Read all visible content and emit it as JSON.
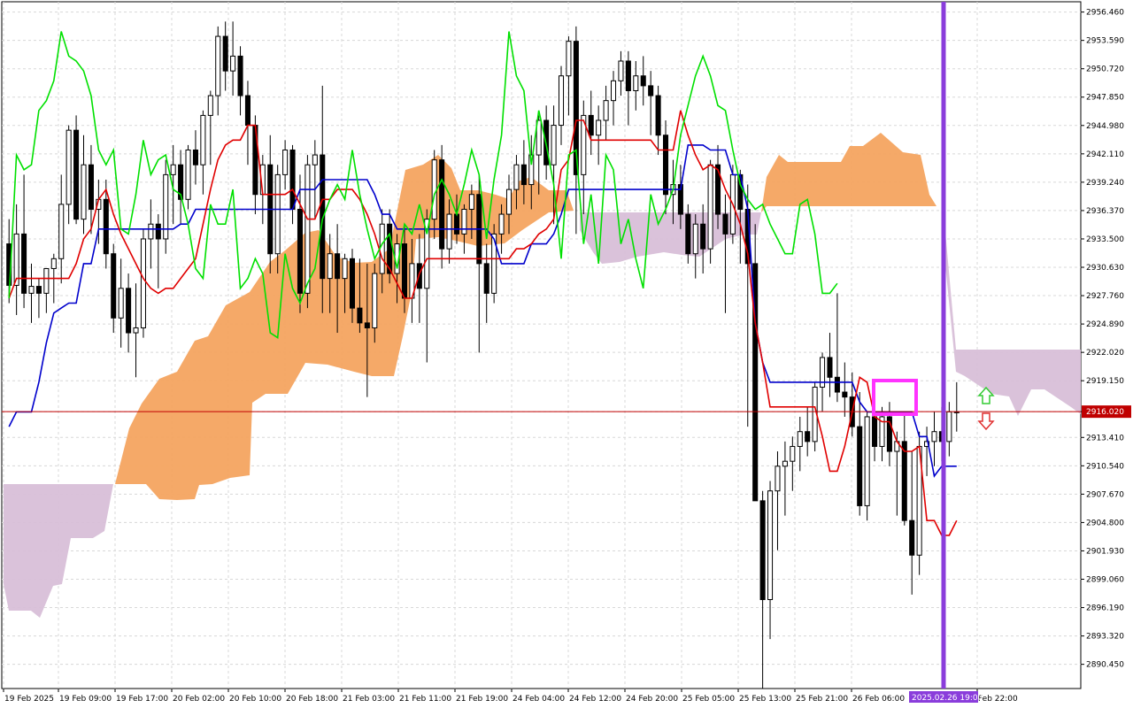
{
  "chart_data": {
    "type": "candlestick",
    "ylim": [
      2888.0,
      2957.5
    ],
    "grid": true,
    "y_ticks": [
      "2956.460",
      "2953.590",
      "2950.720",
      "2947.850",
      "2944.980",
      "2942.110",
      "2939.240",
      "2936.370",
      "2933.500",
      "2930.630",
      "2927.760",
      "2924.890",
      "2922.020",
      "2919.150",
      "2916.020",
      "2913.410",
      "2910.540",
      "2907.670",
      "2904.800",
      "2901.930",
      "2899.060",
      "2896.190",
      "2893.320",
      "2890.450"
    ],
    "x_ticks": [
      "19 Feb 2025",
      "19 Feb 09:00",
      "19 Feb 17:00",
      "20 Feb 02:00",
      "20 Feb 10:00",
      "20 Feb 18:00",
      "21 Feb 03:00",
      "21 Feb 11:00",
      "21 Feb 19:00",
      "24 Feb 04:00",
      "24 Feb 12:00",
      "24 Feb 20:00",
      "25 Feb 05:00",
      "25 Feb 13:00",
      "25 Feb 21:00",
      "26 Feb 06:00",
      "Feb 22:00"
    ],
    "current_price": "2916.020",
    "current_price_color": "#c00000",
    "highlight_time": "2025.02.26 19:00",
    "highlight_color": "#8a3ddb",
    "arrows": {
      "up_color": "#33cc33",
      "down_color": "#e03030"
    },
    "series_colors": {
      "tenkan": "#e00000",
      "kijun": "#0000cc",
      "chikou": "#00e000",
      "kumo_bull": "#f4a460",
      "kumo_bear": "#d8bfd8",
      "candle": "#000000",
      "marker": "#ff33ff"
    },
    "candles": [
      [
        2933.0,
        2935.5,
        2927.0,
        2928.8
      ],
      [
        2928.8,
        2937.0,
        2925.8,
        2934.0
      ],
      [
        2934.0,
        2940.0,
        2926.5,
        2928.0
      ],
      [
        2928.0,
        2931.0,
        2925.0,
        2928.7
      ],
      [
        2928.7,
        2929.5,
        2925.5,
        2928.0
      ],
      [
        2928.0,
        2930.5,
        2926.0,
        2930.5
      ],
      [
        2930.5,
        2932.0,
        2927.0,
        2931.5
      ],
      [
        2931.5,
        2940.0,
        2929.0,
        2937.0
      ],
      [
        2937.0,
        2945.0,
        2935.0,
        2944.5
      ],
      [
        2944.5,
        2946.0,
        2935.0,
        2935.5
      ],
      [
        2935.5,
        2944.0,
        2934.0,
        2941.0
      ],
      [
        2941.0,
        2943.0,
        2934.0,
        2936.5
      ],
      [
        2936.5,
        2939.5,
        2933.0,
        2937.5
      ],
      [
        2937.5,
        2939.5,
        2930.5,
        2932.0
      ],
      [
        2932.0,
        2933.0,
        2924.0,
        2925.5
      ],
      [
        2925.5,
        2931.5,
        2922.5,
        2928.5
      ],
      [
        2928.5,
        2930.0,
        2922.0,
        2924.0
      ],
      [
        2924.0,
        2929.0,
        2919.5,
        2924.5
      ],
      [
        2924.5,
        2934.5,
        2923.5,
        2933.5
      ],
      [
        2933.5,
        2937.5,
        2930.5,
        2935.0
      ],
      [
        2935.0,
        2936.0,
        2928.5,
        2933.5
      ],
      [
        2933.5,
        2941.5,
        2932.0,
        2940.0
      ],
      [
        2940.0,
        2943.0,
        2935.0,
        2941.0
      ],
      [
        2941.0,
        2942.5,
        2935.0,
        2937.5
      ],
      [
        2937.5,
        2943.0,
        2936.5,
        2942.5
      ],
      [
        2942.5,
        2944.5,
        2939.0,
        2941.0
      ],
      [
        2941.0,
        2946.5,
        2938.0,
        2946.0
      ],
      [
        2946.0,
        2948.5,
        2941.0,
        2948.0
      ],
      [
        2948.0,
        2955.0,
        2946.0,
        2954.0
      ],
      [
        2954.0,
        2955.5,
        2948.5,
        2950.5
      ],
      [
        2950.5,
        2955.5,
        2948.0,
        2952.0
      ],
      [
        2952.0,
        2953.0,
        2946.0,
        2948.0
      ],
      [
        2948.0,
        2949.5,
        2941.0,
        2945.0
      ],
      [
        2945.0,
        2946.0,
        2936.0,
        2938.0
      ],
      [
        2938.0,
        2942.0,
        2935.0,
        2941.0
      ],
      [
        2941.0,
        2944.0,
        2930.0,
        2932.0
      ],
      [
        2932.0,
        2941.0,
        2930.0,
        2940.0
      ],
      [
        2940.0,
        2943.5,
        2938.5,
        2942.5
      ],
      [
        2942.5,
        2943.0,
        2935.0,
        2936.5
      ],
      [
        2936.5,
        2940.0,
        2926.0,
        2928.0
      ],
      [
        2928.0,
        2942.0,
        2926.5,
        2941.0
      ],
      [
        2941.0,
        2943.5,
        2935.5,
        2942.0
      ],
      [
        2942.0,
        2949.0,
        2926.0,
        2929.5
      ],
      [
        2929.5,
        2934.0,
        2926.0,
        2932.0
      ],
      [
        2932.0,
        2935.0,
        2924.0,
        2929.5
      ],
      [
        2929.5,
        2932.0,
        2926.0,
        2931.5
      ],
      [
        2931.5,
        2932.5,
        2925.0,
        2926.5
      ],
      [
        2926.5,
        2931.5,
        2924.0,
        2925.0
      ],
      [
        2925.0,
        2931.0,
        2917.5,
        2924.5
      ],
      [
        2924.5,
        2931.0,
        2923.0,
        2930.0
      ],
      [
        2930.0,
        2936.5,
        2928.0,
        2935.0
      ],
      [
        2935.0,
        2936.5,
        2929.0,
        2930.0
      ],
      [
        2930.0,
        2934.0,
        2927.0,
        2933.0
      ],
      [
        2933.0,
        2935.0,
        2926.0,
        2927.5
      ],
      [
        2927.5,
        2933.5,
        2925.0,
        2931.0
      ],
      [
        2931.0,
        2934.0,
        2925.0,
        2928.5
      ],
      [
        2928.5,
        2936.5,
        2921.0,
        2935.5
      ],
      [
        2935.5,
        2942.5,
        2933.5,
        2941.5
      ],
      [
        2941.5,
        2943.0,
        2930.5,
        2932.5
      ],
      [
        2932.5,
        2937.5,
        2931.0,
        2936.0
      ],
      [
        2936.0,
        2938.0,
        2933.0,
        2934.0
      ],
      [
        2934.0,
        2937.0,
        2932.0,
        2936.5
      ],
      [
        2936.5,
        2939.0,
        2933.5,
        2938.0
      ],
      [
        2938.0,
        2940.0,
        2922.0,
        2931.0
      ],
      [
        2931.0,
        2933.0,
        2925.0,
        2928.0
      ],
      [
        2928.0,
        2935.0,
        2927.0,
        2934.0
      ],
      [
        2934.0,
        2937.0,
        2932.0,
        2936.0
      ],
      [
        2936.0,
        2940.0,
        2934.0,
        2938.5
      ],
      [
        2938.5,
        2942.0,
        2936.5,
        2941.0
      ],
      [
        2941.0,
        2943.5,
        2937.0,
        2939.0
      ],
      [
        2939.0,
        2944.0,
        2936.5,
        2942.0
      ],
      [
        2942.0,
        2946.0,
        2938.0,
        2945.5
      ],
      [
        2945.5,
        2947.0,
        2939.5,
        2941.0
      ],
      [
        2941.0,
        2947.0,
        2935.0,
        2945.0
      ],
      [
        2945.0,
        2951.0,
        2943.0,
        2950.0
      ],
      [
        2950.0,
        2954.0,
        2946.0,
        2953.5
      ],
      [
        2953.5,
        2955.0,
        2934.0,
        2940.0
      ],
      [
        2940.0,
        2947.5,
        2936.0,
        2946.0
      ],
      [
        2946.0,
        2948.5,
        2942.0,
        2944.0
      ],
      [
        2944.0,
        2947.0,
        2941.0,
        2945.5
      ],
      [
        2945.5,
        2949.0,
        2943.5,
        2947.5
      ],
      [
        2947.5,
        2950.5,
        2945.0,
        2949.5
      ],
      [
        2949.5,
        2952.5,
        2948.0,
        2951.5
      ],
      [
        2951.5,
        2952.5,
        2945.0,
        2948.5
      ],
      [
        2948.5,
        2951.5,
        2946.5,
        2950.0
      ],
      [
        2950.0,
        2952.0,
        2947.0,
        2949.0
      ],
      [
        2949.0,
        2950.5,
        2944.0,
        2948.0
      ],
      [
        2948.0,
        2949.0,
        2942.0,
        2944.0
      ],
      [
        2944.0,
        2945.5,
        2936.0,
        2938.0
      ],
      [
        2938.0,
        2941.5,
        2935.0,
        2939.0
      ],
      [
        2939.0,
        2941.0,
        2934.5,
        2936.0
      ],
      [
        2936.0,
        2937.0,
        2931.0,
        2932.0
      ],
      [
        2932.0,
        2936.0,
        2929.5,
        2935.0
      ],
      [
        2935.0,
        2937.0,
        2930.0,
        2932.5
      ],
      [
        2932.5,
        2941.5,
        2931.0,
        2941.0
      ],
      [
        2941.0,
        2943.0,
        2934.5,
        2936.0
      ],
      [
        2936.0,
        2938.0,
        2926.0,
        2934.0
      ],
      [
        2934.0,
        2941.0,
        2933.0,
        2940.0
      ],
      [
        2940.0,
        2940.5,
        2931.0,
        2936.5
      ],
      [
        2936.5,
        2939.0,
        2914.5,
        2931.0
      ],
      [
        2931.0,
        2935.0,
        2908.0,
        2907.0
      ],
      [
        2907.0,
        2908.0,
        2888.0,
        2897.0
      ],
      [
        2897.0,
        2909.0,
        2893.0,
        2908.0
      ],
      [
        2908.0,
        2912.0,
        2902.0,
        2910.5
      ],
      [
        2910.5,
        2913.0,
        2905.5,
        2911.0
      ],
      [
        2911.0,
        2913.5,
        2908.0,
        2912.5
      ],
      [
        2912.5,
        2915.5,
        2910.0,
        2914.0
      ],
      [
        2914.0,
        2916.5,
        2911.5,
        2913.0
      ],
      [
        2913.0,
        2919.0,
        2912.0,
        2918.5
      ],
      [
        2918.5,
        2922.0,
        2916.0,
        2921.5
      ],
      [
        2921.5,
        2924.0,
        2917.5,
        2919.5
      ],
      [
        2919.5,
        2928.0,
        2917.0,
        2918.0
      ],
      [
        2918.0,
        2921.0,
        2915.5,
        2917.5
      ],
      [
        2917.5,
        2920.0,
        2913.5,
        2914.5
      ],
      [
        2914.5,
        2918.0,
        2905.5,
        2906.5
      ],
      [
        2906.5,
        2916.0,
        2905.0,
        2915.5
      ],
      [
        2915.5,
        2918.5,
        2911.0,
        2912.5
      ],
      [
        2912.5,
        2916.5,
        2911.0,
        2915.5
      ],
      [
        2915.5,
        2917.0,
        2910.5,
        2912.0
      ],
      [
        2912.0,
        2914.0,
        2905.5,
        2913.0
      ],
      [
        2913.0,
        2916.0,
        2904.5,
        2905.0
      ],
      [
        2905.0,
        2912.0,
        2897.5,
        2901.5
      ],
      [
        2901.5,
        2914.0,
        2899.5,
        2912.5
      ],
      [
        2912.5,
        2914.5,
        2909.5,
        2913.0
      ],
      [
        2913.0,
        2916.0,
        2910.5,
        2914.0
      ],
      [
        2914.0,
        2916.5,
        2911.0,
        2913.0
      ],
      [
        2913.0,
        2917.0,
        2911.5,
        2916.0
      ],
      [
        2916.0,
        2919.0,
        2914.0,
        2916.0
      ]
    ],
    "kijun_values": [
      2914.5,
      2916.0,
      2916.0,
      2916.0,
      2919.0,
      2923.0,
      2926.0,
      2926.5,
      2927.0,
      2927.0,
      2931.0,
      2931.0,
      2934.5,
      2934.5,
      2934.5,
      2934.5,
      2934.5,
      2934.5,
      2934.5,
      2934.5,
      2934.5,
      2934.5,
      2934.5,
      2935.0,
      2935.0,
      2936.5,
      2936.5,
      2936.5,
      2936.5,
      2936.5,
      2936.5,
      2936.5,
      2936.5,
      2936.5,
      2936.5,
      2936.5,
      2936.5,
      2936.5,
      2936.5,
      2938.5,
      2938.5,
      2938.5,
      2939.5,
      2939.5,
      2939.5,
      2939.5,
      2939.5,
      2939.5,
      2939.5,
      2938.0,
      2936.0,
      2936.0,
      2934.5,
      2934.5,
      2934.5,
      2934.5,
      2934.5,
      2934.5,
      2934.5,
      2934.5,
      2934.5,
      2934.5,
      2934.5,
      2934.5,
      2934.5,
      2933.5,
      2931.0,
      2931.0,
      2931.0,
      2931.0,
      2933.0,
      2933.0,
      2933.0,
      2934.0,
      2936.0,
      2938.5,
      2938.5,
      2938.5,
      2938.5,
      2938.5,
      2938.5,
      2938.5,
      2938.5,
      2938.5,
      2938.5,
      2938.5,
      2938.5,
      2938.5,
      2938.5,
      2938.5,
      2938.5,
      2943.0,
      2943.0,
      2943.0,
      2942.5,
      2942.5,
      2942.5,
      2940.0,
      2940.0,
      2936.5,
      2925.0,
      2921.0,
      2919.0,
      2919.0,
      2919.0,
      2919.0,
      2919.0,
      2919.0,
      2919.0,
      2919.0,
      2919.0,
      2919.0,
      2919.0,
      2919.0,
      2917.0,
      2916.0,
      2916.0,
      2916.0,
      2916.0,
      2916.0,
      2916.0,
      2916.0,
      2913.5,
      2913.5,
      2909.5,
      2910.5,
      2910.5,
      2910.5
    ],
    "tenkan_values": [
      2927.5,
      2929.5,
      2929.5,
      2929.5,
      2929.5,
      2929.5,
      2929.5,
      2929.5,
      2929.5,
      2931.0,
      2933.5,
      2934.5,
      2937.5,
      2938.5,
      2936.0,
      2934.0,
      2932.5,
      2931.0,
      2929.5,
      2928.5,
      2928.0,
      2928.5,
      2928.5,
      2929.5,
      2930.5,
      2931.5,
      2935.0,
      2938.5,
      2941.5,
      2943.0,
      2943.5,
      2943.5,
      2945.0,
      2945.0,
      2938.0,
      2938.0,
      2938.0,
      2938.0,
      2938.5,
      2937.0,
      2935.5,
      2935.5,
      2937.5,
      2937.5,
      2938.5,
      2938.5,
      2938.5,
      2937.5,
      2936.0,
      2934.0,
      2931.5,
      2930.5,
      2929.0,
      2927.5,
      2927.5,
      2930.0,
      2931.5,
      2931.5,
      2931.5,
      2931.5,
      2931.5,
      2931.5,
      2931.5,
      2931.5,
      2931.5,
      2931.5,
      2931.5,
      2931.5,
      2932.5,
      2932.5,
      2933.0,
      2934.0,
      2934.5,
      2935.5,
      2940.5,
      2941.5,
      2945.5,
      2945.5,
      2943.5,
      2943.5,
      2943.5,
      2943.5,
      2943.5,
      2943.5,
      2943.5,
      2943.5,
      2943.5,
      2942.5,
      2942.5,
      2942.5,
      2946.5,
      2944.0,
      2942.0,
      2940.5,
      2941.0,
      2940.5,
      2938.5,
      2937.0,
      2935.0,
      2932.0,
      2925.0,
      2921.0,
      2916.5,
      2916.5,
      2916.5,
      2916.5,
      2916.5,
      2916.5,
      2916.5,
      2913.5,
      2910.0,
      2910.0,
      2912.5,
      2916.0,
      2919.5,
      2919.0,
      2915.5,
      2915.0,
      2915.0,
      2913.0,
      2912.0,
      2912.0,
      2912.5,
      2905.0,
      2905.0,
      2903.5,
      2903.5,
      2905.0
    ],
    "chikou_values": [
      2927.5,
      2942.0,
      2940.5,
      2941.0,
      2946.5,
      2947.5,
      2949.5,
      2954.5,
      2952.0,
      2951.5,
      2950.5,
      2948.0,
      2942.5,
      2941.0,
      2942.5,
      2934.5,
      2934.0,
      2938.0,
      2943.5,
      2940.0,
      2941.5,
      2942.0,
      2938.5,
      2938.0,
      2935.0,
      2930.5,
      2929.5,
      2937.0,
      2935.0,
      2935.0,
      2938.5,
      2928.5,
      2929.5,
      2931.5,
      2930.0,
      2924.0,
      2923.5,
      2932.0,
      2928.5,
      2927.0,
      2929.0,
      2930.5,
      2935.5,
      2937.5,
      2939.0,
      2937.5,
      2942.5,
      2938.0,
      2934.5,
      2931.5,
      2933.0,
      2934.0,
      2930.5,
      2935.0,
      2934.0,
      2937.0,
      2934.0,
      2938.0,
      2939.5,
      2938.0,
      2936.0,
      2939.0,
      2942.5,
      2940.0,
      2933.5,
      2939.5,
      2944.0,
      2954.5,
      2950.0,
      2948.5,
      2941.0,
      2946.5,
      2943.0,
      2939.0,
      2931.5,
      2942.0,
      2942.5,
      2933.0,
      2938.0,
      2931.0,
      2942.0,
      2940.5,
      2933.0,
      2935.5,
      2931.5,
      2928.5,
      2938.0,
      2935.0,
      2936.5,
      2938.5,
      2944.0,
      2947.0,
      2950.0,
      2952.0,
      2950.0,
      2947.0,
      2946.5,
      2942.5,
      2939.0,
      2937.5,
      2936.5,
      2937.0,
      2935.0,
      2933.5,
      2932.0,
      2932.0,
      2937.0,
      2937.5,
      2934.0,
      2928.0,
      2928.0,
      2929.0
    ]
  },
  "axis": {
    "highlight_label": "2025.02.26 19:00"
  }
}
